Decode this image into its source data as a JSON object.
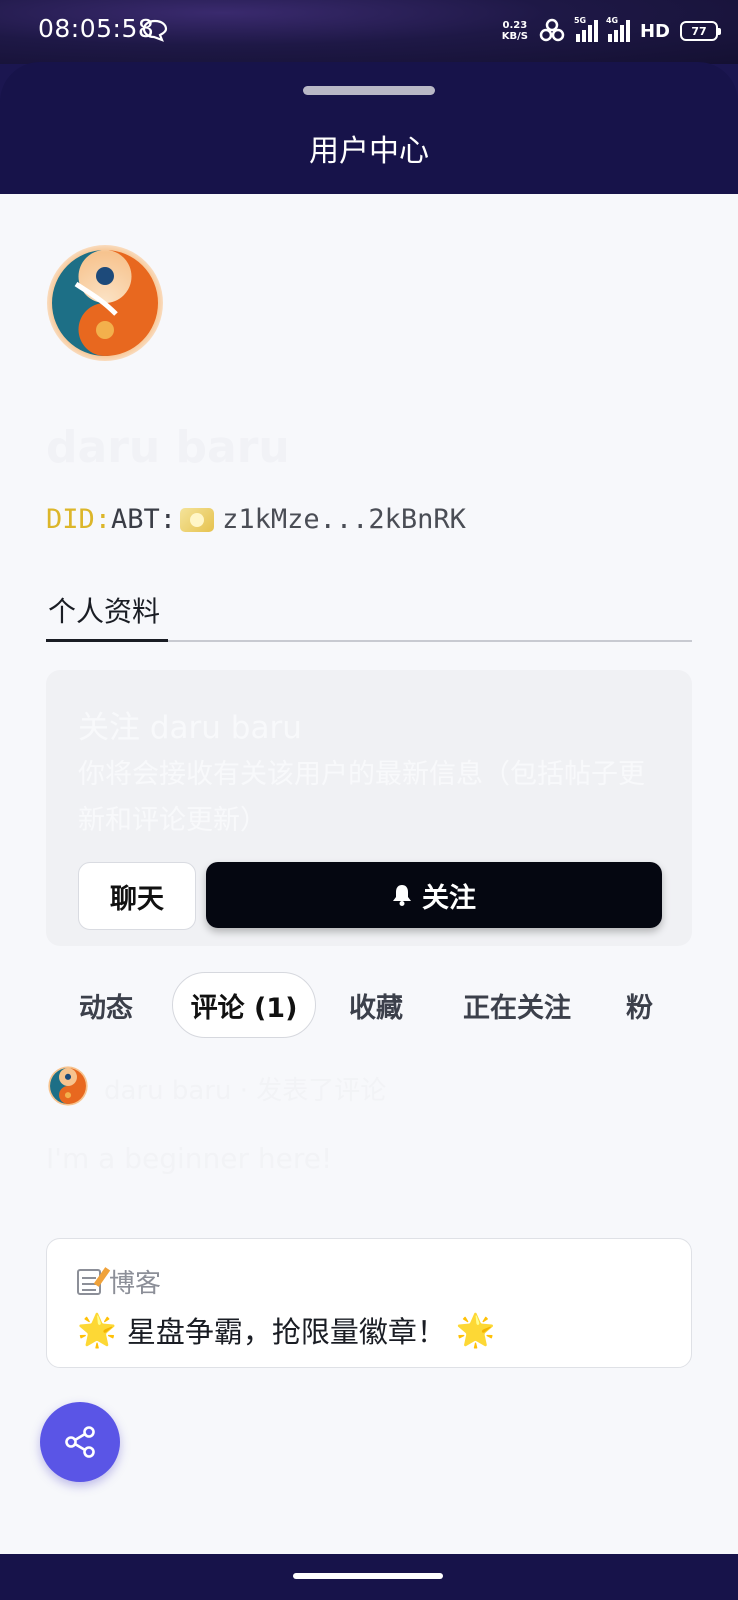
{
  "status_bar": {
    "time": "08:05:58",
    "net_speed_value": "0.23",
    "net_speed_unit": "KB/S",
    "sim1_tag": "5G",
    "sim2_tag": "4G",
    "hd_label": "HD",
    "battery": "77"
  },
  "header": {
    "title": "用户中心"
  },
  "profile": {
    "name": "daru baru",
    "did_prefix": "DID:",
    "did_type": "ABT:",
    "did_address": "z1kMze...2kBnRK",
    "tab_label": "个人资料"
  },
  "follow_card": {
    "title": "关注 daru baru",
    "description": "你将会接收有关该用户的最新信息（包括帖子更新和评论更新）",
    "chat_button": "聊天",
    "follow_button": "关注"
  },
  "tabs": [
    {
      "label": "动态"
    },
    {
      "label": "评论 (1)"
    },
    {
      "label": "收藏"
    },
    {
      "label": "正在关注"
    },
    {
      "label": "粉"
    }
  ],
  "comment": {
    "author": "daru baru · 发表了评论",
    "text": "I'm a beginner here!"
  },
  "blog_card": {
    "label": "博客",
    "title": "星盘争霸，抢限量徽章！",
    "star": "🌟"
  },
  "colors": {
    "header_bg": "#17134a",
    "fab": "#5a55e6",
    "did_accent": "#dcb62a"
  }
}
